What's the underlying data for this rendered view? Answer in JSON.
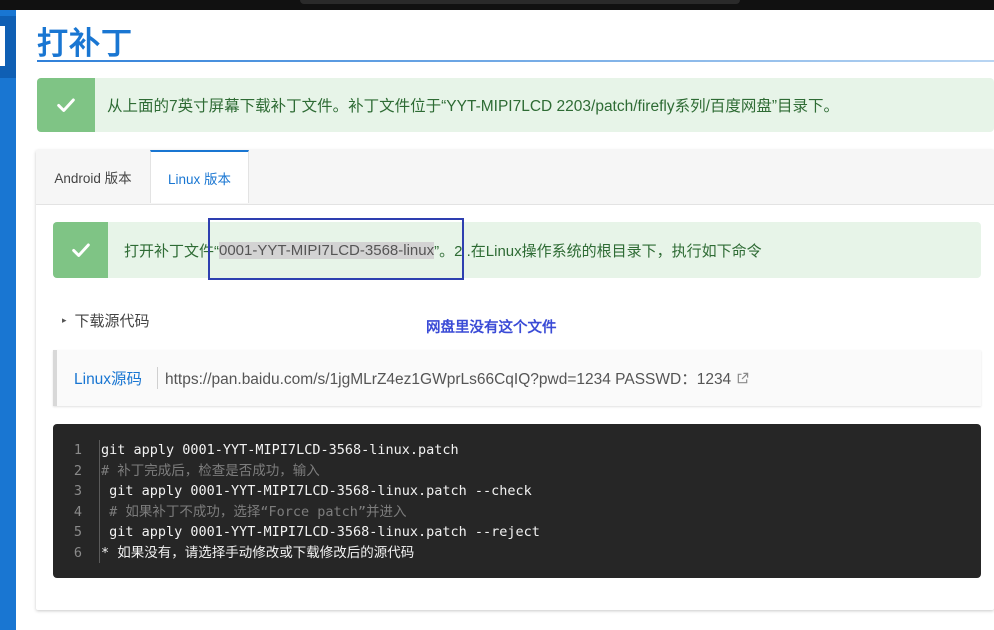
{
  "page": {
    "title": "打补丁"
  },
  "top_alert": {
    "text": "从上面的7英寸屏幕下载补丁文件。补丁文件位于“YYT-MIPI7LCD 2203/patch/firefly系列/百度网盘”目录下。"
  },
  "tabs": [
    {
      "label": "Android 版本",
      "active": false
    },
    {
      "label": "Linux 版本",
      "active": true
    }
  ],
  "patch_alert": {
    "text_before": "打开补丁文件“",
    "file_name": "0001-YYT-MIPI7LCD-3568-linux",
    "text_after": "”。2 .在Linux操作系统的根目录下，执行如下命令"
  },
  "details": {
    "summary": "下载源代码"
  },
  "annotation": {
    "text": "网盘里没有这个文件"
  },
  "source_link": {
    "label": "Linux源码",
    "url": "https://pan.baidu.com/s/1jgMLrZ4ez1GWprLs66CqIQ?pwd=1234 PASSWD：1234"
  },
  "code_block": {
    "line_numbers": [
      "1",
      "2",
      "3",
      "4",
      "5",
      "6"
    ],
    "lines": [
      {
        "text": "git apply 0001-YYT-MIPI7LCD-3568-linux.patch",
        "comment": false
      },
      {
        "text": "# 补丁完成后，检查是否成功，输入",
        "comment": true
      },
      {
        "text": " git apply 0001-YYT-MIPI7LCD-3568-linux.patch --check",
        "comment": false
      },
      {
        "text": " # 如果补丁不成功，选择“Force patch”并进入",
        "comment": true
      },
      {
        "text": " git apply 0001-YYT-MIPI7LCD-3568-linux.patch --reject",
        "comment": false
      },
      {
        "text": "* 如果没有，请选择手动修改或下载修改后的源代码",
        "comment": false
      }
    ]
  },
  "colors": {
    "accent": "#1976d2",
    "alert_bg": "#e7f4e8",
    "alert_icon_bg": "#7fc485",
    "alert_text": "#2e6b34",
    "annotation": "#3a4bd6",
    "highlight_box": "#2e3fb0",
    "code_bg": "#262626"
  },
  "icons": [
    "check-icon",
    "caret-right-icon",
    "external-link-icon"
  ]
}
